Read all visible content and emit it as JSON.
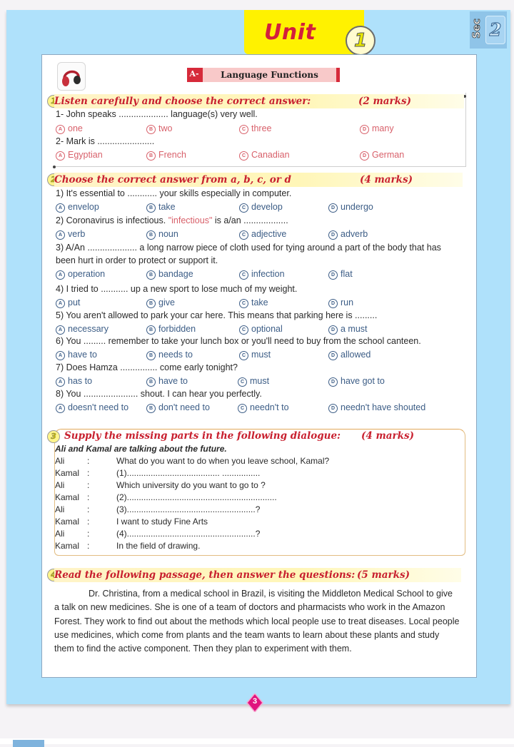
{
  "header": {
    "unit_label": "Unit",
    "unit_number": "1",
    "sec_label": "Sec",
    "sec_number": "2"
  },
  "section_banner": {
    "badge": "A-",
    "title": "Language Functions",
    "icon": "headphones-icon"
  },
  "q1": {
    "number": "1",
    "title": "Listen carefully and choose the correct answer:",
    "marks": "(2 marks)",
    "items": [
      {
        "stem": "1-  John speaks .................... language(s) very well.",
        "options": [
          "one",
          "two",
          "three",
          "many"
        ]
      },
      {
        "stem": "2- Mark is .......................",
        "options": [
          "Egyptian",
          "French",
          "Canadian",
          "German"
        ]
      }
    ]
  },
  "q2": {
    "number": "2",
    "title": "Choose the correct answer from a, b, c, or d",
    "marks": "(4 marks)",
    "items": [
      {
        "stem": "1) It's essential to ............ your skills especially in computer.",
        "options": [
          "envelop",
          "take",
          "develop",
          "undergo"
        ]
      },
      {
        "stem_pre": "2) Coronavirus is infectious. ",
        "stem_quote": "\"infectious\"",
        "stem_post": " is a/an ..................",
        "options": [
          "verb",
          "noun",
          "adjective",
          "adverb"
        ]
      },
      {
        "stem": "3) A/An .................... a long narrow piece of cloth used for tying around a part of the body that has",
        "stem2": "been hurt in order to protect or support it.",
        "options": [
          "operation",
          "bandage",
          "infection",
          "flat"
        ]
      },
      {
        "stem": "4) I tried to ........... up a new sport to lose much of my weight.",
        "options": [
          "put",
          "give",
          "take",
          "run"
        ]
      },
      {
        "stem": "5) You aren't allowed to park your car here. This means that parking here is .........",
        "options": [
          "necessary",
          "forbidden",
          "optional",
          "a must"
        ]
      },
      {
        "stem": "6) You ......... remember to take your lunch box or you'll need to buy from the school canteen.",
        "options": [
          "have to",
          "needs to",
          "must",
          "allowed"
        ]
      },
      {
        "stem": "7) Does Hamza ............... come early tonight?",
        "options": [
          "has to",
          "have to",
          "must",
          "have got to"
        ]
      },
      {
        "stem": "8) You ...................... shout. I can hear you perfectly.",
        "options": [
          "doesn't need to",
          "don't need to",
          "needn't to",
          "needn't have shouted"
        ]
      }
    ],
    "option_letters": [
      "A",
      "B",
      "C",
      "D"
    ]
  },
  "q3": {
    "number": "3",
    "title": "Supply the missing parts in the following dialogue:",
    "marks": "(4 marks)",
    "intro": "Ali and Kamal are talking about the future.",
    "lines": [
      {
        "speaker": "Ali",
        "text": "What do you want to do when you leave school, Kamal?"
      },
      {
        "speaker": "Kamal",
        "text": "(1)....................................... ................"
      },
      {
        "speaker": "Ali",
        "text": "Which university do you want to go to ?"
      },
      {
        "speaker": "Kamal",
        "text": "(2)..............................................................."
      },
      {
        "speaker": "Ali",
        "text": "(3)......................................................?"
      },
      {
        "speaker": "Kamal",
        "text": "I want to study Fine Arts"
      },
      {
        "speaker": "Ali",
        "text": "(4)......................................................?"
      },
      {
        "speaker": "Kamal",
        "text": "In the field of drawing."
      }
    ]
  },
  "q4": {
    "number": "4",
    "title": "Read the following passage, then answer the questions:",
    "marks": "(5 marks)",
    "passage": "Dr. Christina, from a medical school in Brazil, is visiting the Middleton Medical School to give a talk on new medicines. She is one of a team of doctors and pharmacists who work in the Amazon Forest. They work to find out about the methods which local people use to treat diseases. Local people use medicines, which come from plants and the team wants to learn about these plants and study them to find the active component. Then they plan to experiment with them."
  },
  "footer": {
    "page_number": "3"
  },
  "colors": {
    "page_background": "#afe1fb",
    "unit_tab": "#fff200",
    "heading_red": "#c8202f",
    "q1_option": "#d8606a",
    "q2_option": "#3c5d86",
    "page_marker": "#e0157e"
  }
}
